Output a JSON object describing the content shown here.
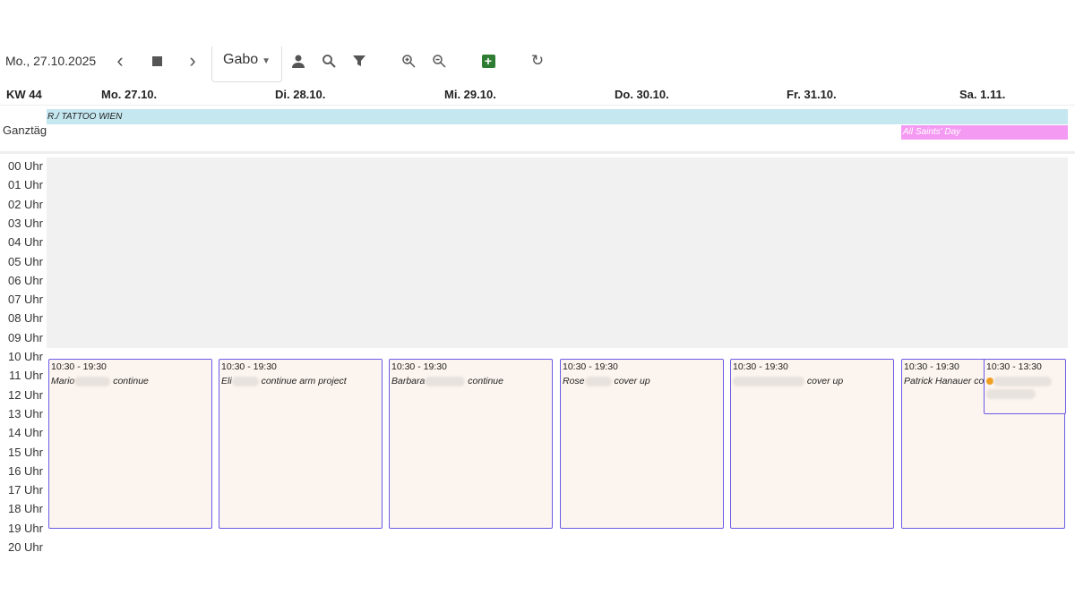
{
  "toolbar": {
    "date": "Mo., 27.10.2025",
    "staff": "Gabo",
    "colors": {
      "add": "#2e7d32"
    }
  },
  "header": {
    "week": "KW 44",
    "days": [
      "Mo. 27.10.",
      "Di. 28.10.",
      "Mi. 29.10.",
      "Do. 30.10.",
      "Fr. 31.10.",
      "Sa. 1.11."
    ]
  },
  "allday": {
    "label": "Ganztägig",
    "band": "R./ TATTOO WIEN",
    "holiday": "All Saints' Day"
  },
  "hours": [
    "00 Uhr",
    "01 Uhr",
    "02 Uhr",
    "03 Uhr",
    "04 Uhr",
    "05 Uhr",
    "06 Uhr",
    "07 Uhr",
    "08 Uhr",
    "09 Uhr",
    "10 Uhr",
    "11 Uhr",
    "12 Uhr",
    "13 Uhr",
    "14 Uhr",
    "15 Uhr",
    "16 Uhr",
    "17 Uhr",
    "18 Uhr",
    "19 Uhr",
    "20 Uhr"
  ],
  "events": [
    {
      "time": "10:30 - 19:30",
      "name": "Mario",
      "desc": "continue"
    },
    {
      "time": "10:30 - 19:30",
      "name": "Eli",
      "desc": "continue arm project"
    },
    {
      "time": "10:30 - 19:30",
      "name": "Barbara",
      "desc": "continue"
    },
    {
      "time": "10:30 - 19:30",
      "name": "Rose",
      "desc": "cover up"
    },
    {
      "time": "10:30 - 19:30",
      "name": "",
      "desc": "cover up"
    },
    {
      "time": "10:30 - 19:30",
      "name": "Patrick Hanauer",
      "desc": "co"
    },
    {
      "time": "10:30 - 13:30",
      "name": "",
      "desc": ""
    }
  ]
}
